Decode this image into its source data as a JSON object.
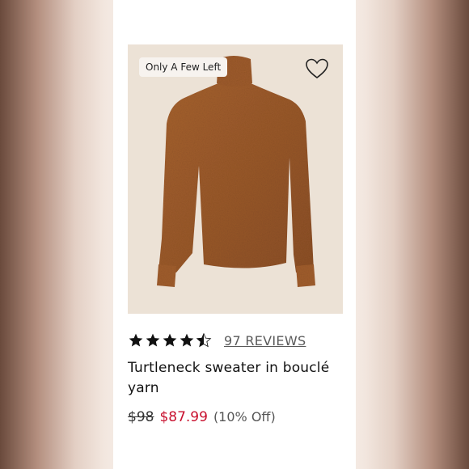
{
  "product": {
    "badge": "Only A Few Left",
    "rating": 4.5,
    "rating_max": 5,
    "reviews_label": "97 REVIEWS",
    "title": "Turtleneck sweater in bouclé yarn",
    "original_price": "$98",
    "sale_price": "$87.99",
    "discount": "(10% Off)"
  },
  "icons": {
    "wishlist": "heart-outline-icon",
    "rating": "star-icon"
  },
  "colors": {
    "sale": "#c8102e",
    "sweater": "#9a5a2c",
    "image_bg": "#ece2d6"
  }
}
